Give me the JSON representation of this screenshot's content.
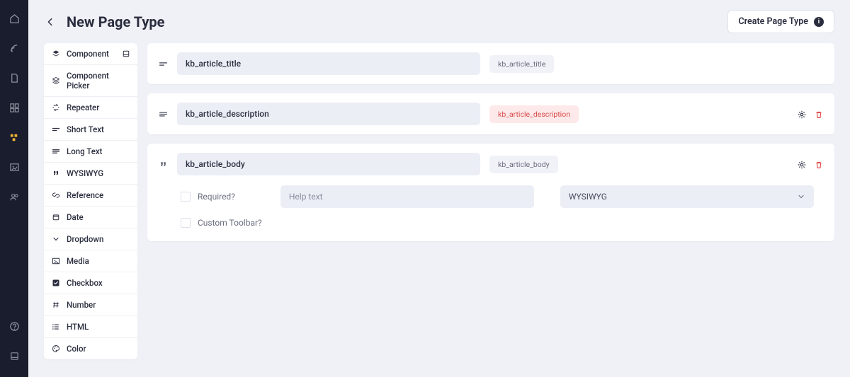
{
  "header": {
    "page_title": "New Page Type",
    "create_button": "Create Page Type"
  },
  "palette": [
    {
      "icon": "layers",
      "label": "Component",
      "has_side": true
    },
    {
      "icon": "stack",
      "label": "Component Picker"
    },
    {
      "icon": "repeat",
      "label": "Repeater"
    },
    {
      "icon": "short",
      "label": "Short Text"
    },
    {
      "icon": "long",
      "label": "Long Text"
    },
    {
      "icon": "quote",
      "label": "WYSIWYG"
    },
    {
      "icon": "link",
      "label": "Reference"
    },
    {
      "icon": "calendar",
      "label": "Date"
    },
    {
      "icon": "chevdown",
      "label": "Dropdown"
    },
    {
      "icon": "image",
      "label": "Media"
    },
    {
      "icon": "check",
      "label": "Checkbox"
    },
    {
      "icon": "hash",
      "label": "Number"
    },
    {
      "icon": "list",
      "label": "HTML"
    },
    {
      "icon": "palette",
      "label": "Color"
    }
  ],
  "fields": [
    {
      "icon": "short",
      "name": "kb_article_title",
      "tag": "kb_article_title",
      "warn": false,
      "show_actions": false,
      "expanded": false
    },
    {
      "icon": "long",
      "name": "kb_article_description",
      "tag": "kb_article_description",
      "warn": true,
      "show_actions": true,
      "expanded": false
    },
    {
      "icon": "quote",
      "name": "kb_article_body",
      "tag": "kb_article_body",
      "warn": false,
      "show_actions": true,
      "expanded": true
    }
  ],
  "config": {
    "required_label": "Required?",
    "help_placeholder": "Help text",
    "type_value": "WYSIWYG",
    "custom_toolbar_label": "Custom Toolbar?"
  }
}
